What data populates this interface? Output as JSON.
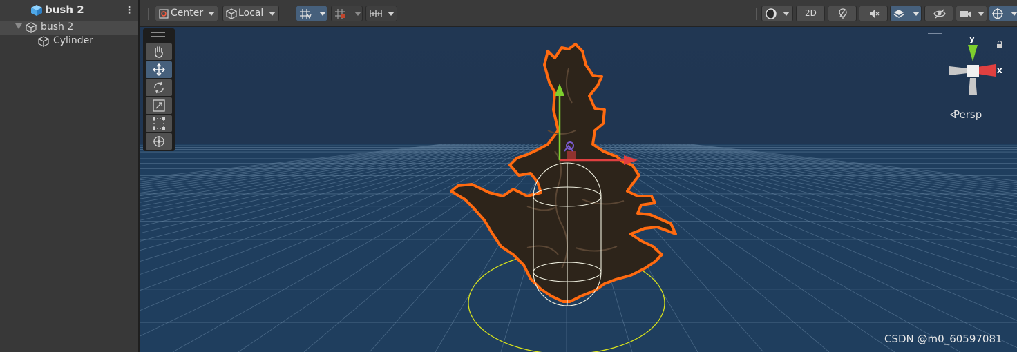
{
  "hierarchy": {
    "title": "bush 2",
    "items": [
      {
        "label": "bush 2",
        "selected": true
      },
      {
        "label": "Cylinder",
        "selected": false
      }
    ]
  },
  "toolbar": {
    "pivot_mode": "Center",
    "pivot_rotation": "Local",
    "two_d_label": "2D"
  },
  "tools": [
    {
      "name": "hand-tool",
      "icon": "hand-icon"
    },
    {
      "name": "move-tool",
      "icon": "move-icon"
    },
    {
      "name": "rotate-tool",
      "icon": "rotate-icon"
    },
    {
      "name": "scale-tool",
      "icon": "scale-icon"
    },
    {
      "name": "rect-tool",
      "icon": "rect-icon"
    },
    {
      "name": "transform-tool",
      "icon": "transform-icon"
    }
  ],
  "scene": {
    "view_mode": "Persp",
    "axis_y": "y",
    "axis_x": "x",
    "watermark": "CSDN @m0_60597081"
  },
  "colors": {
    "scene_bg": "#203550",
    "selection_outline": "#ff6a10",
    "active_button": "#46607c",
    "axis_x": "#e04040",
    "axis_y": "#7ecf2e"
  }
}
